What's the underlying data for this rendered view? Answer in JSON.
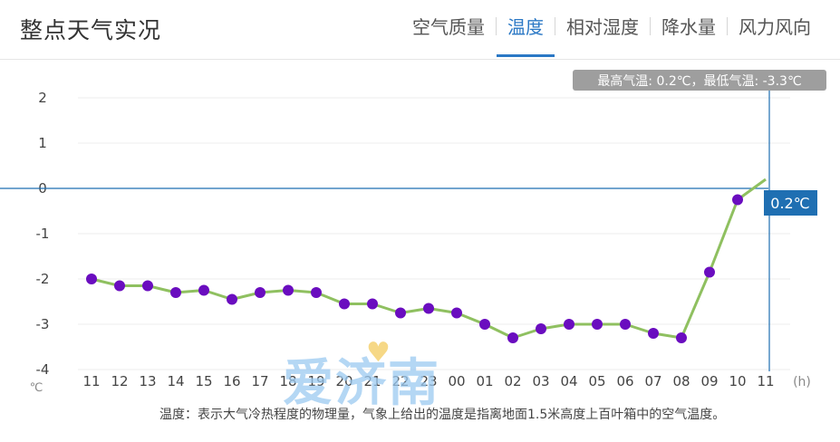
{
  "header": {
    "title": "整点天气实况",
    "tabs": [
      {
        "label": "空气质量",
        "active": false
      },
      {
        "label": "温度",
        "active": true
      },
      {
        "label": "相对湿度",
        "active": false
      },
      {
        "label": "降水量",
        "active": false
      },
      {
        "label": "风力风向",
        "active": false
      }
    ]
  },
  "colors": {
    "accent": "#2b78c5",
    "line": "#8fc060",
    "point": "#6a0dbf",
    "label_bg": "#1f6fb2",
    "summary_bg": "#9e9e9e"
  },
  "watermark": {
    "text": "爱济南",
    "heart": "♥"
  },
  "note": "温度：表示大气冷热程度的物理量，气象上给出的温度是指离地面1.5米高度上百叶箱中的空气温度。",
  "chart_data": {
    "type": "line",
    "x": [
      "11",
      "12",
      "13",
      "14",
      "15",
      "16",
      "17",
      "18",
      "19",
      "20",
      "21",
      "22",
      "23",
      "00",
      "01",
      "02",
      "03",
      "04",
      "05",
      "06",
      "07",
      "08",
      "09",
      "10",
      "11"
    ],
    "y": [
      -2.0,
      -2.15,
      -2.15,
      -2.3,
      -2.25,
      -2.45,
      -2.3,
      -2.25,
      -2.3,
      -2.55,
      -2.55,
      -2.75,
      -2.65,
      -2.75,
      -3.0,
      -3.3,
      -3.1,
      -3.0,
      -3.0,
      -3.0,
      -3.2,
      -3.3,
      -1.85,
      -0.25,
      0.2
    ],
    "y_ticks": [
      "2",
      "1",
      "0",
      "-1",
      "-2",
      "-3",
      "-4"
    ],
    "ylim": [
      -4,
      2
    ],
    "xlabel": "(h)",
    "ylabel": "℃",
    "grid": true,
    "summary": "最高气温: 0.2℃，最低气温: -3.3℃",
    "current_label": "0.2℃"
  }
}
